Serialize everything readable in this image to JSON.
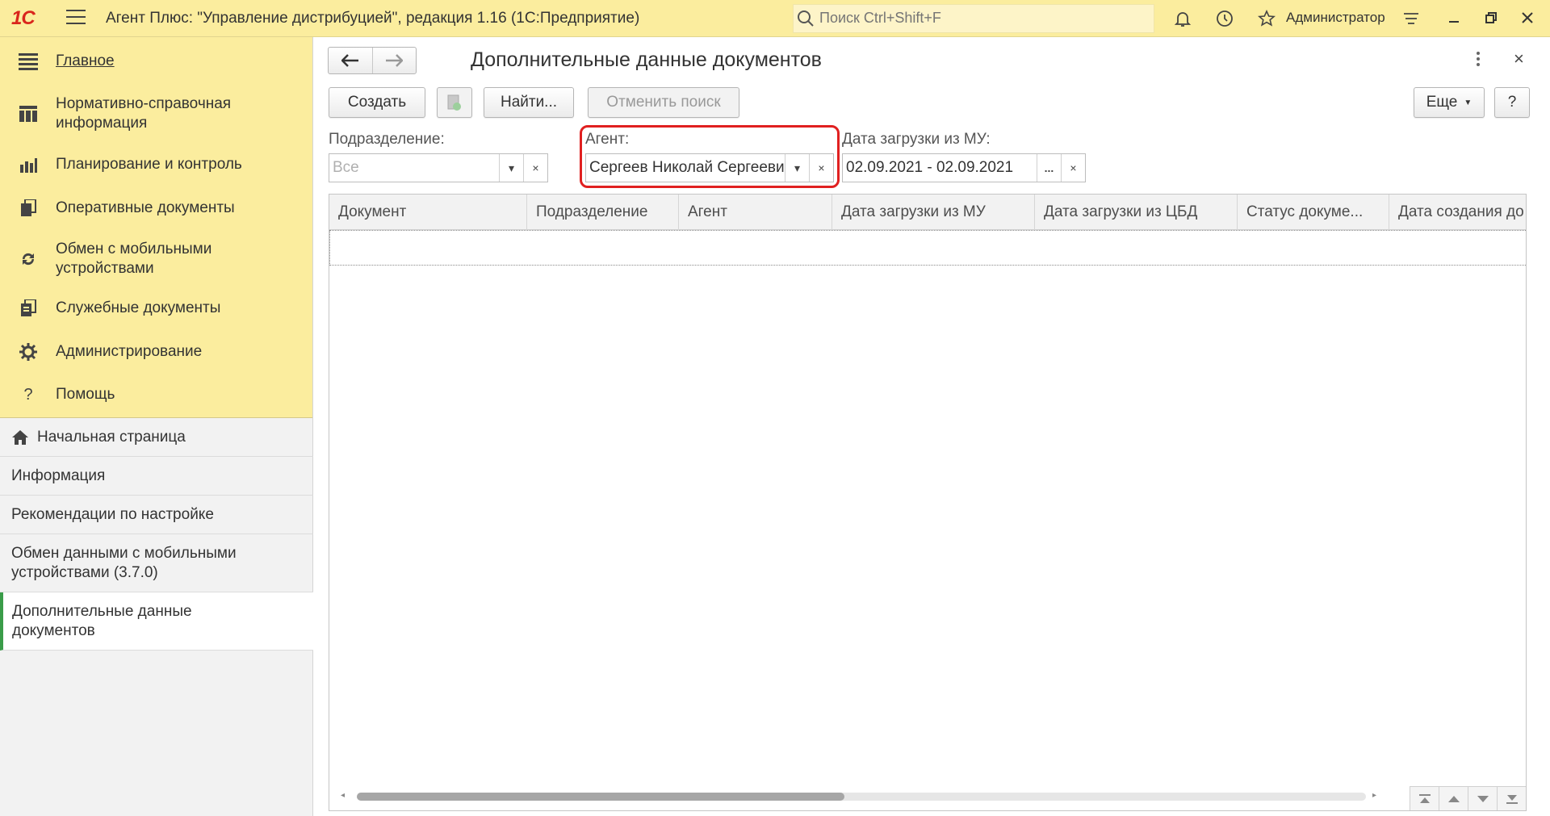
{
  "titlebar": {
    "logo": "1С",
    "title": "Агент Плюс: \"Управление дистрибуцией\", редакция 1.16  (1С:Предприятие)",
    "search_placeholder": "Поиск Ctrl+Shift+F",
    "user": "Администратор",
    "icons": [
      "bell-icon",
      "history-icon",
      "star-icon",
      "settings-lines-icon"
    ],
    "window_controls": [
      "minimize",
      "restore",
      "close"
    ]
  },
  "sections": [
    {
      "label": "Главное",
      "icon": "hamburger-icon"
    },
    {
      "label": "Нормативно-справочная информация",
      "icon": "table-icon"
    },
    {
      "label": "Планирование и контроль",
      "icon": "bar-chart-icon"
    },
    {
      "label": "Оперативные документы",
      "icon": "documents-icon"
    },
    {
      "label": "Обмен с мобильными устройствами",
      "icon": "sync-icon"
    },
    {
      "label": "Служебные документы",
      "icon": "service-docs-icon"
    },
    {
      "label": "Администрирование",
      "icon": "gear-icon"
    },
    {
      "label": "Помощь",
      "icon": "question-icon"
    }
  ],
  "open_windows": [
    {
      "label": "Начальная страница",
      "icon": "home-icon"
    },
    {
      "label": "Информация"
    },
    {
      "label": "Рекомендации по настройке"
    },
    {
      "label": "Обмен данными с мобильными устройствами (3.7.0)"
    },
    {
      "label": "Дополнительные данные документов",
      "active": true
    }
  ],
  "form": {
    "title": "Дополнительные данные документов",
    "buttons": {
      "create": "Создать",
      "find": "Найти...",
      "cancel_search": "Отменить поиск",
      "more": "Еще",
      "help": "?"
    },
    "filters": {
      "subdivision": {
        "label": "Подразделение:",
        "placeholder": "Все",
        "value": ""
      },
      "agent": {
        "label": "Агент:",
        "value": "Сергеев Николай Сергеевич"
      },
      "load_date": {
        "label": "Дата загрузки из МУ:",
        "value": "02.09.2021 - 02.09.2021",
        "choose": "..."
      }
    },
    "table": {
      "columns": [
        "Документ",
        "Подразделение",
        "Агент",
        "Дата загрузки из МУ",
        "Дата загрузки из ЦБД",
        "Статус докуме...",
        "Дата создания до"
      ]
    }
  },
  "colors": {
    "accent_yellow": "#fbed9e",
    "highlight_red": "#e02020",
    "active_green": "#3a9c49",
    "logo_red": "#d9261c"
  }
}
